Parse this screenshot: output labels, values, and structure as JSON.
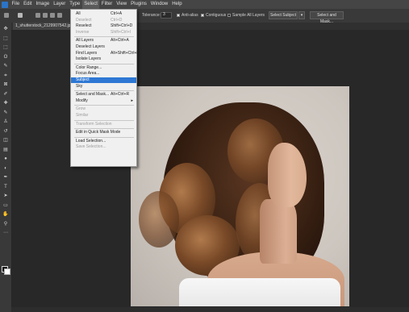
{
  "menubar": {
    "items": [
      "File",
      "Edit",
      "Image",
      "Layer",
      "Type",
      "Select",
      "Filter",
      "View",
      "Plugins",
      "Window",
      "Help"
    ],
    "active_index": 5
  },
  "options_bar": {
    "tolerance_label": "Tolerance:",
    "tolerance_value": "3",
    "anti_alias_label": "Anti-alias",
    "contiguous_label": "Contiguous",
    "sample_all_layers_label": "Sample All Layers",
    "select_subject_label": "Select Subject",
    "select_and_mask_label": "Select and Mask..."
  },
  "document_tab": {
    "title": "1_shutterstock_2129907542.jpeg",
    "close": "×"
  },
  "select_menu": {
    "items": [
      {
        "label": "All",
        "shortcut": "Ctrl+A",
        "state": "normal"
      },
      {
        "label": "Deselect",
        "shortcut": "Ctrl+D",
        "state": "disabled"
      },
      {
        "label": "Reselect",
        "shortcut": "Shift+Ctrl+D",
        "state": "normal"
      },
      {
        "label": "Inverse",
        "shortcut": "Shift+Ctrl+I",
        "state": "disabled"
      },
      {
        "label": "All Layers",
        "shortcut": "Alt+Ctrl+A",
        "state": "normal"
      },
      {
        "label": "Deselect Layers",
        "shortcut": "",
        "state": "normal"
      },
      {
        "label": "Find Layers",
        "shortcut": "Alt+Shift+Ctrl+F",
        "state": "normal"
      },
      {
        "label": "Isolate Layers",
        "shortcut": "",
        "state": "normal"
      },
      {
        "label": "Color Range...",
        "shortcut": "",
        "state": "normal"
      },
      {
        "label": "Focus Area...",
        "shortcut": "",
        "state": "normal"
      },
      {
        "label": "Subject",
        "shortcut": "",
        "state": "highlight"
      },
      {
        "label": "Sky",
        "shortcut": "",
        "state": "normal"
      },
      {
        "label": "Select and Mask...",
        "shortcut": "Alt+Ctrl+R",
        "state": "normal"
      },
      {
        "label": "Modify",
        "shortcut": "",
        "state": "submenu"
      },
      {
        "label": "Grow",
        "shortcut": "",
        "state": "disabled"
      },
      {
        "label": "Similar",
        "shortcut": "",
        "state": "disabled"
      },
      {
        "label": "Transform Selection",
        "shortcut": "",
        "state": "disabled"
      },
      {
        "label": "Edit in Quick Mask Mode",
        "shortcut": "",
        "state": "normal"
      },
      {
        "label": "Load Selection...",
        "shortcut": "",
        "state": "normal"
      },
      {
        "label": "Save Selection...",
        "shortcut": "",
        "state": "disabled"
      }
    ],
    "submenu_arrow": "▸"
  },
  "toolbar": {
    "tools": [
      "move-tool-icon",
      "artboard-icon",
      "marquee-icon",
      "lasso-icon",
      "quick-select-icon",
      "crop-icon",
      "frame-icon",
      "eyedropper-icon",
      "healing-icon",
      "brush-icon",
      "stamp-icon",
      "history-brush-icon",
      "eraser-icon",
      "gradient-icon",
      "blur-icon",
      "dodge-icon",
      "pen-icon",
      "type-icon",
      "path-select-icon",
      "rectangle-icon",
      "hand-icon",
      "zoom-icon",
      "more-tools-icon"
    ],
    "glyphs": [
      "✥",
      "⬚",
      "⬚",
      "ʘ",
      "✎",
      "⌗",
      "⊠",
      "✐",
      "✚",
      "✎",
      "♙",
      "↺",
      "◫",
      "▤",
      "●",
      "◐",
      "✒",
      "T",
      "➤",
      "▭",
      "✋",
      "⚲",
      "⋯"
    ],
    "foreground_color": "#0a0a0a",
    "background_color": "#ffffff"
  },
  "colors": {
    "menu_highlight": "#2e78d4",
    "app_bg": "#282828"
  }
}
